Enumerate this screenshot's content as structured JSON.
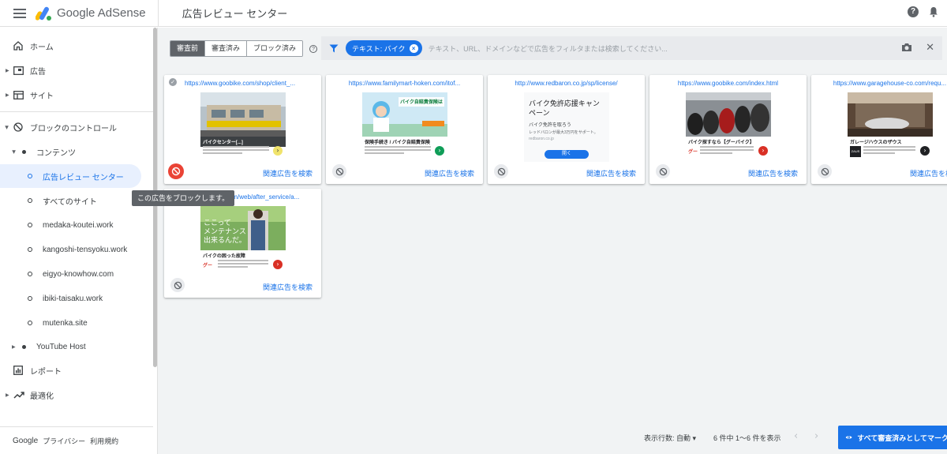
{
  "header": {
    "product_name": "Google AdSense",
    "page_title": "広告レビュー センター"
  },
  "sidebar": {
    "items": [
      {
        "label": "ホーム"
      },
      {
        "label": "広告"
      },
      {
        "label": "サイト"
      },
      {
        "label": "ブロックのコントロール"
      },
      {
        "label": "コンテンツ"
      },
      {
        "label": "広告レビュー センター"
      },
      {
        "label": "すべてのサイト"
      },
      {
        "label": "medaka-koutei.work"
      },
      {
        "label": "kangoshi-tensyoku.work"
      },
      {
        "label": "eigyo-knowhow.com"
      },
      {
        "label": "ibiki-taisaku.work"
      },
      {
        "label": "mutenka.site"
      },
      {
        "label": "YouTube Host"
      },
      {
        "label": "レポート"
      },
      {
        "label": "最適化"
      }
    ],
    "footer": {
      "google": "Google",
      "privacy": "プライバシー",
      "terms": "利用規約"
    }
  },
  "toolbar": {
    "tabs": [
      "審査前",
      "審査済み",
      "ブロック済み"
    ],
    "active_tab": "審査前"
  },
  "filter": {
    "chip_label": "テキスト: バイク",
    "placeholder": "テキスト、URL、ドメインなどで広告をフィルタまたは検索してください..."
  },
  "cards": [
    {
      "url": "https://www.goobike.com/shop/client_...",
      "related": "関連広告を検索",
      "ad_caption": "バイクセンター[...]"
    },
    {
      "url": "https://www.familymart-hoken.com/itof...",
      "related": "関連広告を検索",
      "ad_headline": "バイク自賠責保険は",
      "ad_caption": "保険手続き / バイク自賠責保険"
    },
    {
      "url": "http://www.redbaron.co.jp/sp/license/",
      "related": "関連広告を検索",
      "ad_title": "バイク免許応援キャンペーン",
      "ad_sub": "バイク免許を取ろう",
      "ad_small": "レッドバロンが最大3万円をサポート。",
      "ad_domain": "redbaron.co.jp",
      "ad_btn": "開く"
    },
    {
      "url": "https://www.goobike.com/index.html",
      "related": "関連広告を検索",
      "ad_caption": "バイク探すなら【グーバイク】"
    },
    {
      "url": "https://www.garagehouse-co.com/requ...",
      "related": "関連広告を検索",
      "ad_caption": "ガレージハウスのザウス",
      "ad_brand": "ZAUS"
    },
    {
      "url": "http://goobike.com/web/after_service/a...",
      "related": "関連広告を検索",
      "ad_overlay": "ここって\nメンテナンス\n出来るんだ。",
      "ad_caption": "バイクの困った故障"
    }
  ],
  "tooltip": "この広告をブロックします。",
  "footer": {
    "rows_label": "表示行数:",
    "rows_value": "自動",
    "range": "6 件中 1〜6 件を表示",
    "review_all": "すべて審査済みとしてマーク"
  },
  "colors": {
    "accent": "#1a73e8",
    "block_active": "#ea4335",
    "chip": "#1a73e8"
  }
}
